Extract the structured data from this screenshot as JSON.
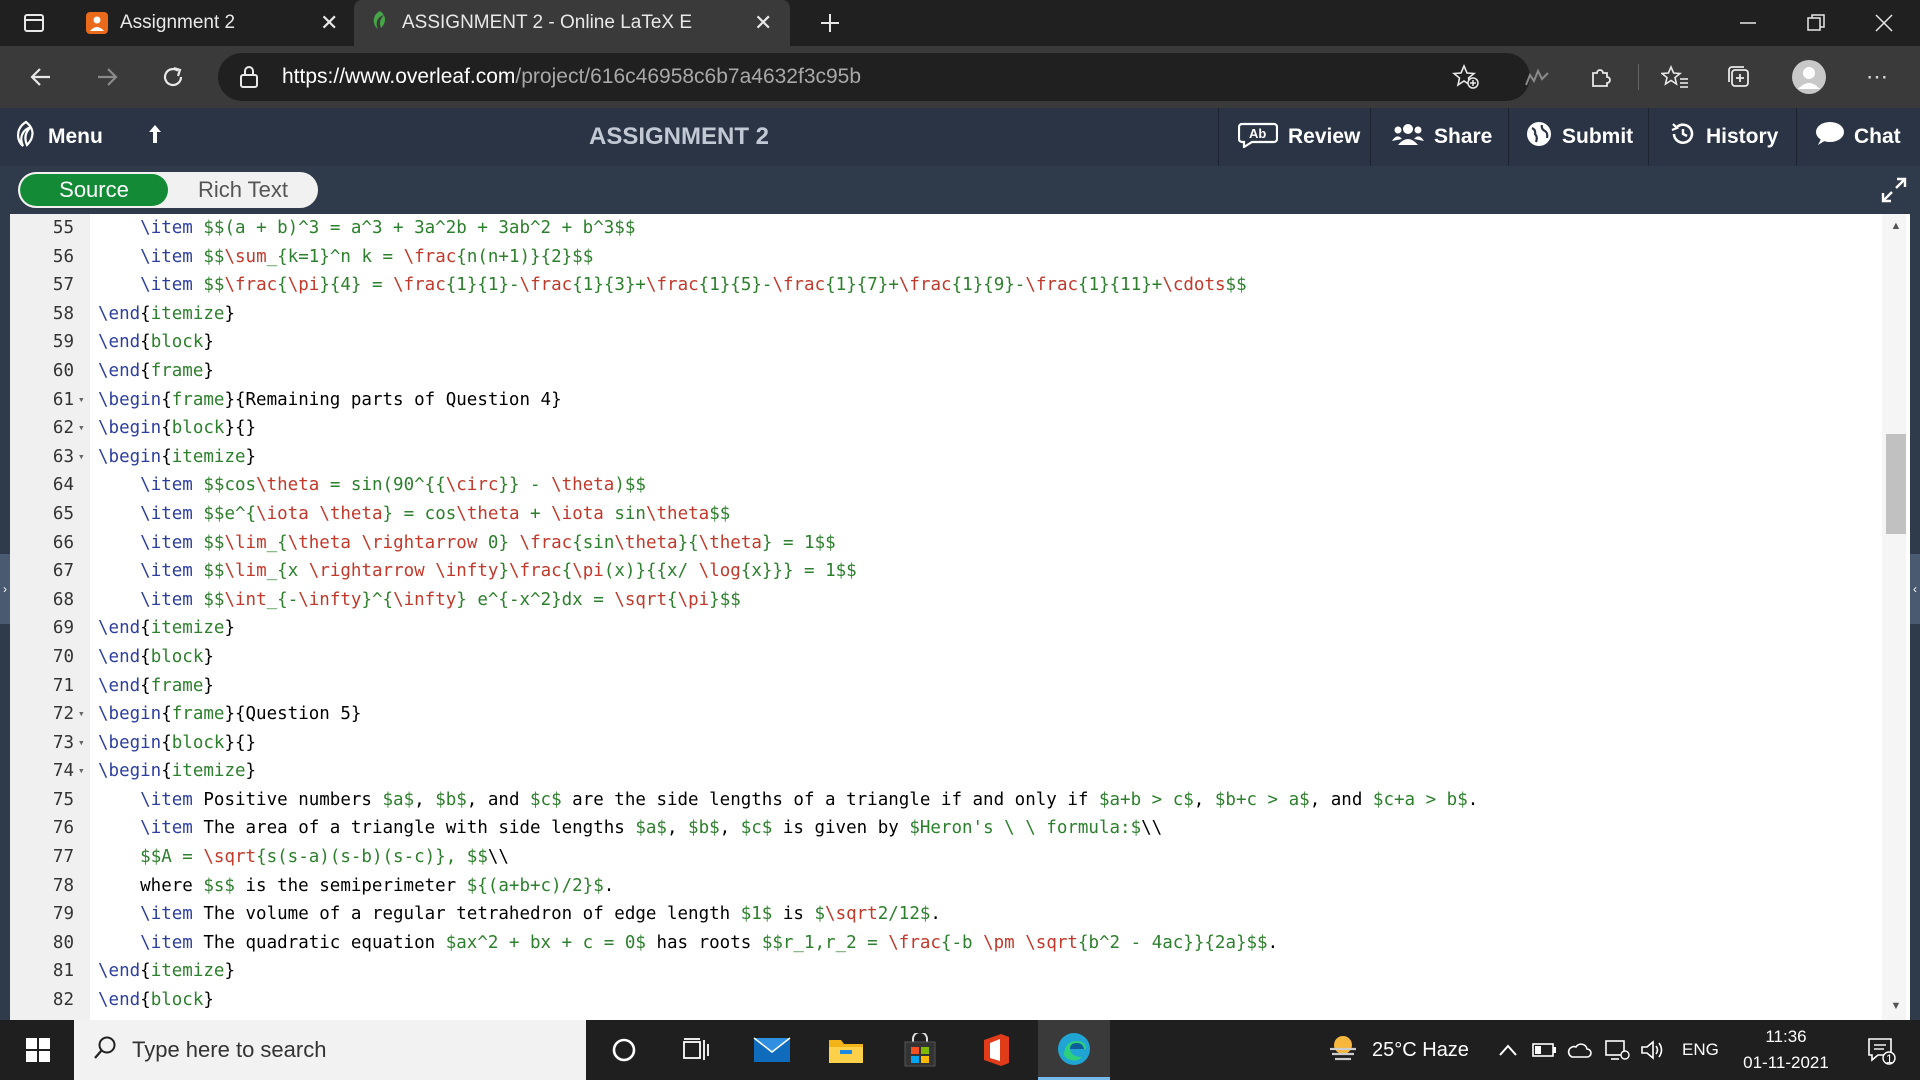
{
  "browser": {
    "tabs": [
      {
        "title": "Assignment 2",
        "active": false
      },
      {
        "title": "ASSIGNMENT 2 - Online LaTeX E",
        "active": true
      }
    ],
    "url_host": "https://www.overleaf.com",
    "url_path": "/project/616c46958c6b7a4632f3c95b"
  },
  "toolbar": {
    "menu_label": "Menu",
    "document_title": "ASSIGNMENT 2",
    "review_label": "Review",
    "share_label": "Share",
    "submit_label": "Submit",
    "history_label": "History",
    "chat_label": "Chat"
  },
  "editor_mode": {
    "source_label": "Source",
    "rich_text_label": "Rich Text",
    "active": "Source"
  },
  "editor": {
    "lines": [
      {
        "n": "55",
        "fold": false,
        "text": "    \\item $$(a + b)^3 = a^3 + 3a^2b + 3ab^2 + b^3$$"
      },
      {
        "n": "56",
        "fold": false,
        "text": "    \\item $$\\sum_{k=1}^n k = \\frac{n(n+1)}{2}$$"
      },
      {
        "n": "57",
        "fold": false,
        "text": "    \\item $$\\frac{\\pi}{4} = \\frac{1}{1}-\\frac{1}{3}+\\frac{1}{5}-\\frac{1}{7}+\\frac{1}{9}-\\frac{1}{11}+\\cdots$$"
      },
      {
        "n": "58",
        "fold": false,
        "text": "\\end{itemize}"
      },
      {
        "n": "59",
        "fold": false,
        "text": "\\end{block}"
      },
      {
        "n": "60",
        "fold": false,
        "text": "\\end{frame}"
      },
      {
        "n": "61",
        "fold": true,
        "text": "\\begin{frame}{Remaining parts of Question 4}"
      },
      {
        "n": "62",
        "fold": true,
        "text": "\\begin{block}{}"
      },
      {
        "n": "63",
        "fold": true,
        "text": "\\begin{itemize}"
      },
      {
        "n": "64",
        "fold": false,
        "text": "    \\item $$cos\\theta = sin(90^{{\\circ}} - \\theta)$$"
      },
      {
        "n": "65",
        "fold": false,
        "text": "    \\item $$e^{\\iota \\theta} = cos\\theta + \\iota sin\\theta$$"
      },
      {
        "n": "66",
        "fold": false,
        "text": "    \\item $$\\lim_{\\theta \\rightarrow 0} \\frac{sin\\theta}{\\theta} = 1$$"
      },
      {
        "n": "67",
        "fold": false,
        "text": "    \\item $$\\lim_{x \\rightarrow \\infty}\\frac{\\pi(x)}{{x/ \\log{x}}} = 1$$"
      },
      {
        "n": "68",
        "fold": false,
        "text": "    \\item $$\\int_{-\\infty}^{\\infty} e^{-x^2}dx = \\sqrt{\\pi}$$"
      },
      {
        "n": "69",
        "fold": false,
        "text": "\\end{itemize}"
      },
      {
        "n": "70",
        "fold": false,
        "text": "\\end{block}"
      },
      {
        "n": "71",
        "fold": false,
        "text": "\\end{frame}"
      },
      {
        "n": "72",
        "fold": true,
        "text": "\\begin{frame}{Question 5}"
      },
      {
        "n": "73",
        "fold": true,
        "text": "\\begin{block}{}"
      },
      {
        "n": "74",
        "fold": true,
        "text": "\\begin{itemize}"
      },
      {
        "n": "75",
        "fold": false,
        "text": "    \\item Positive numbers $a$, $b$, and $c$ are the side lengths of a triangle if and only if $a+b > c$, $b+c > a$, and $c+a > b$."
      },
      {
        "n": "76",
        "fold": false,
        "text": "    \\item The area of a triangle with side lengths $a$, $b$, $c$ is given by $Heron's \\ \\ formula:$\\\\"
      },
      {
        "n": "77",
        "fold": false,
        "text": "    $$A = \\sqrt{s(s-a)(s-b)(s-c)}, $$\\\\"
      },
      {
        "n": "78",
        "fold": false,
        "text": "    where $s$ is the semiperimeter ${(a+b+c)/2}$."
      },
      {
        "n": "79",
        "fold": false,
        "text": "    \\item The volume of a regular tetrahedron of edge length $1$ is $\\sqrt2/12$."
      },
      {
        "n": "80",
        "fold": false,
        "text": "    \\item The quadratic equation $ax^2 + bx + c = 0$ has roots $$r_1,r_2 = \\frac{-b \\pm \\sqrt{b^2 - 4ac}}{2a}$$."
      },
      {
        "n": "81",
        "fold": false,
        "text": "\\end{itemize}"
      },
      {
        "n": "82",
        "fold": false,
        "text": "\\end{block}"
      }
    ]
  },
  "colors": {
    "command": "#2c3e9e",
    "env": "#2c7f2c",
    "math": "#2c7f2c",
    "mathcmd": "#c0392b",
    "text": "#000000"
  },
  "taskbar": {
    "search_placeholder": "Type here to search",
    "weather": "25°C  Haze",
    "language": "ENG",
    "time": "11:36",
    "date": "01-11-2021",
    "notification_count": "1"
  }
}
